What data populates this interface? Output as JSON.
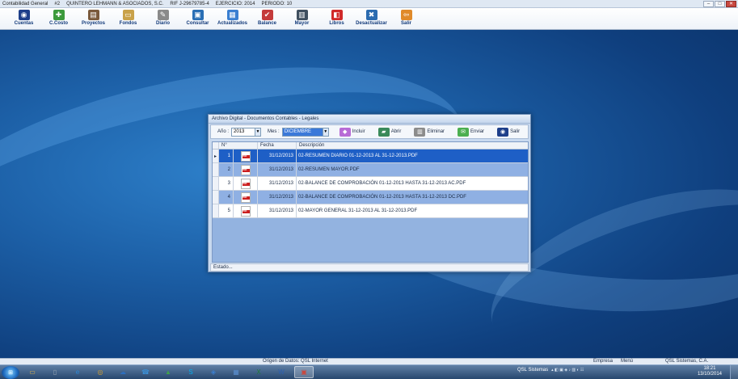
{
  "window": {
    "title": "Contabilidad General",
    "num": "#2",
    "company": "QUINTERO LEHMANN & ASOCIADOS, S.C.",
    "rif": "RIF J-29679785-4",
    "ejercicio": "EJERCICIO: 2014",
    "periodo": "PERIODO: 10",
    "min": "–",
    "max": "□",
    "close": "✕"
  },
  "toolbar": [
    {
      "label": "Cuentas",
      "icon": "cuentas-icon",
      "color": "#1e3f8a",
      "glyph": "◉"
    },
    {
      "label": "C.Costo",
      "icon": "ccosto-icon",
      "color": "#3c9a3c",
      "glyph": "✚"
    },
    {
      "label": "Proyectos",
      "icon": "proyectos-icon",
      "color": "#7a5a3c",
      "glyph": "▤"
    },
    {
      "label": "Fondos",
      "icon": "fondos-icon",
      "color": "#c9a24a",
      "glyph": "▭"
    },
    {
      "label": "Diario",
      "icon": "diario-icon",
      "color": "#8a8a8a",
      "glyph": "✎"
    },
    {
      "label": "Consultar",
      "icon": "consultar-icon",
      "color": "#2a6fb5",
      "glyph": "▣"
    },
    {
      "label": "Actualizados",
      "icon": "actualizados-icon",
      "color": "#3a7fd1",
      "glyph": "▦"
    },
    {
      "label": "Balance",
      "icon": "balance-icon",
      "color": "#c43b3b",
      "glyph": "✔"
    },
    {
      "label": "Mayor",
      "icon": "mayor-icon",
      "color": "#3f4f5f",
      "glyph": "▥"
    },
    {
      "label": "Libros",
      "icon": "libros-icon",
      "color": "#d02a2a",
      "glyph": "◧"
    },
    {
      "label": "Desactualizar",
      "icon": "desactualizar-icon",
      "color": "#2c6cb0",
      "glyph": "✖"
    },
    {
      "label": "Salir",
      "icon": "salir-icon",
      "color": "#e08a2a",
      "glyph": "⇦"
    }
  ],
  "dialog": {
    "title": "Archivo Digital - Documentos Contables - Legales",
    "anio_label": "Año :",
    "anio_value": "2013",
    "mes_label": "Mes :",
    "mes_value": "DICIEMBRE",
    "buttons": [
      {
        "label": "Incluir",
        "icon": "incluir-icon",
        "color": "#b86bd6",
        "glyph": "◆"
      },
      {
        "label": "Abrir",
        "icon": "abrir-icon",
        "color": "#3a8a5a",
        "glyph": "▰"
      },
      {
        "label": "Eliminar",
        "icon": "eliminar-icon",
        "color": "#8c8c8c",
        "glyph": "▥"
      },
      {
        "label": "Enviar",
        "icon": "enviar-icon",
        "color": "#4caf50",
        "glyph": "✉"
      },
      {
        "label": "Salir",
        "icon": "salir-dialog-icon",
        "color": "#1e3f8a",
        "glyph": "◉"
      }
    ],
    "columns": [
      "N°",
      "Fecha",
      "Descripción"
    ],
    "rows": [
      {
        "n": "1",
        "fecha": "31/12/2013",
        "desc": "02-RESUMEN DIARIO 01-12-2013  AL  31-12-2013.PDF",
        "style": "sel"
      },
      {
        "n": "2",
        "fecha": "31/12/2013",
        "desc": "02-RESUMEN MAYOR.PDF",
        "style": "blue"
      },
      {
        "n": "3",
        "fecha": "31/12/2013",
        "desc": "02-BALANCE DE COMPROBACIÓN 01-12-2013 HASTA 31-12-2013 AC.PDF",
        "style": "white"
      },
      {
        "n": "4",
        "fecha": "31/12/2013",
        "desc": "02-BALANCE DE COMPROBACIÓN 01-12-2013 HASTA 31-12-2013 DC.PDF",
        "style": "blue"
      },
      {
        "n": "5",
        "fecha": "31/12/2013",
        "desc": "02-MAYOR GENERAL 31-12-2013 AL 31-12-2013.PDF",
        "style": "white"
      }
    ],
    "estado": "Estado..."
  },
  "statusbar": {
    "origen": "Origen de Datos: QSL Internet",
    "empresa": "Empresa",
    "menu": "Menú",
    "qsl": "QSL Sistemas, C.A."
  },
  "taskbar": {
    "items": [
      {
        "icon": "folder-icon",
        "color": "#e3b64a",
        "glyph": "▭"
      },
      {
        "icon": "document-icon",
        "color": "#9aa7b5",
        "glyph": "▯"
      },
      {
        "icon": "internet-explorer-icon",
        "color": "#2a86d6",
        "glyph": "e"
      },
      {
        "icon": "chrome-icon",
        "color": "#d9a02a",
        "glyph": "◎"
      },
      {
        "icon": "cloud-icon",
        "color": "#2d6fbf",
        "glyph": "☁"
      },
      {
        "icon": "phone-icon",
        "color": "#3a8fd6",
        "glyph": "☎"
      },
      {
        "icon": "drive-icon",
        "color": "#3fa14a",
        "glyph": "▲"
      },
      {
        "icon": "skype-icon",
        "color": "#00aff0",
        "glyph": "S"
      },
      {
        "icon": "network-icon",
        "color": "#3a7fd1",
        "glyph": "◈"
      },
      {
        "icon": "app-icon",
        "color": "#5a8fd0",
        "glyph": "▦"
      },
      {
        "icon": "excel-icon",
        "color": "#1f7a3a",
        "glyph": "X"
      },
      {
        "icon": "word-icon",
        "color": "#2b5fb0",
        "glyph": "W"
      },
      {
        "icon": "contabilidad-icon",
        "color": "#c9483f",
        "glyph": "▣"
      }
    ],
    "tray_label": "QSL Sistemas",
    "time": "18:21",
    "date": "13/10/2014"
  }
}
